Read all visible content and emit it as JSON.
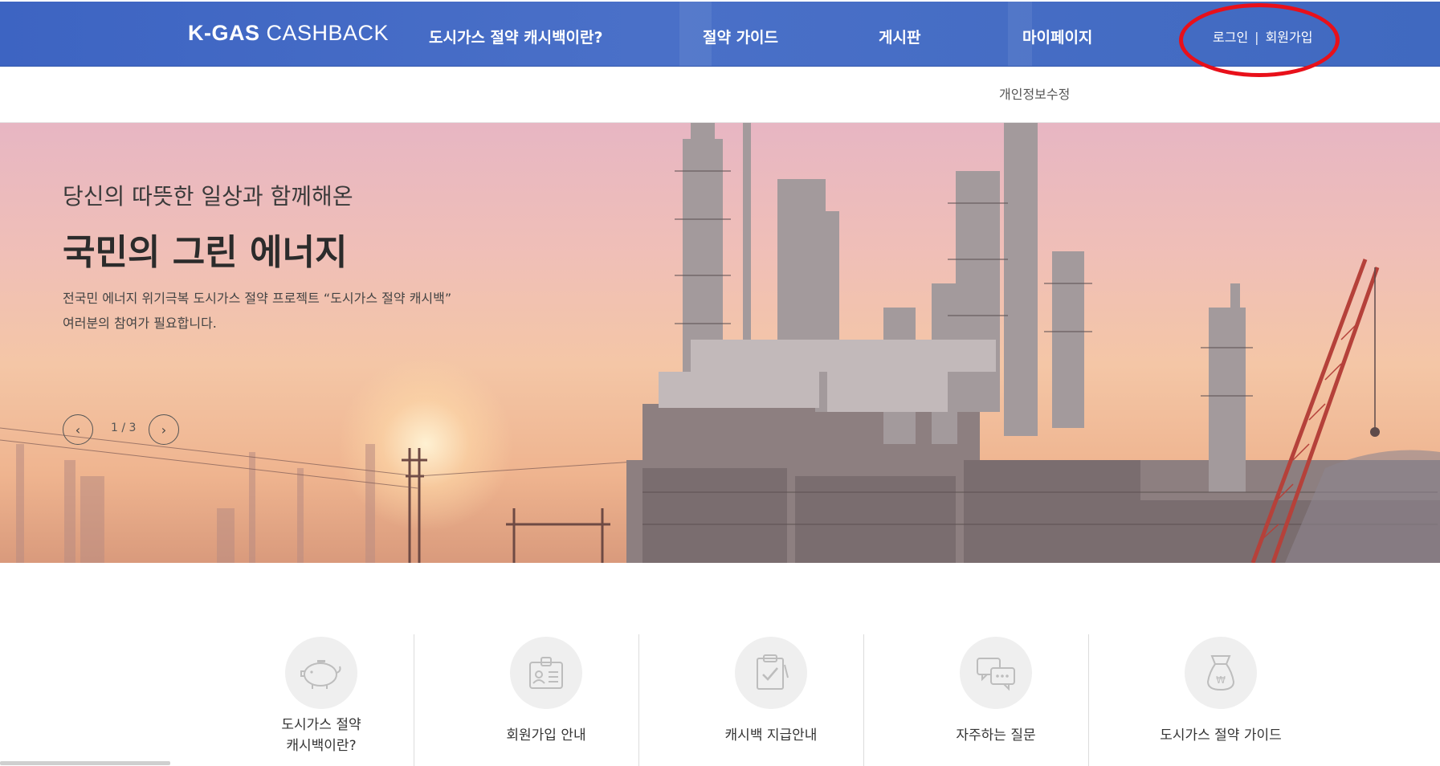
{
  "header": {
    "logo_bold": "K-GAS",
    "logo_thin": "CASHBACK",
    "nav": [
      {
        "label": "도시가스 절약 캐시백이란?"
      },
      {
        "label": "절약 가이드"
      },
      {
        "label": "게시판"
      },
      {
        "label": "마이페이지"
      }
    ],
    "login": "로그인",
    "separator": "|",
    "signup": "회원가입"
  },
  "submenu": {
    "edit_profile": "개인정보수정"
  },
  "hero": {
    "subtitle": "당신의 따뜻한 일상과 함께해온",
    "title": "국민의 그린 에너지",
    "desc_line1": "전국민 에너지 위기극복 도시가스 절약 프로젝트 “도시가스 절약 캐시백”",
    "desc_line2": "여러분의 참여가 필요합니다.",
    "prev_icon": "chevron-left-icon",
    "next_icon": "chevron-right-icon",
    "prev_glyph": "‹",
    "next_glyph": "›",
    "pager": "1 / 3"
  },
  "quick_menu": [
    {
      "icon": "piggy-bank-icon",
      "label_line1": "도시가스 절약",
      "label_line2": "캐시백이란?"
    },
    {
      "icon": "id-card-icon",
      "label_line1": "회원가입 안내",
      "label_line2": ""
    },
    {
      "icon": "clipboard-check-icon",
      "label_line1": "캐시백 지급안내",
      "label_line2": ""
    },
    {
      "icon": "chat-bubbles-icon",
      "label_line1": "자주하는 질문",
      "label_line2": ""
    },
    {
      "icon": "money-bag-icon",
      "label_line1": "도시가스 절약 가이드",
      "label_line2": ""
    }
  ],
  "colors": {
    "header_bg": "#4069c0",
    "highlight_ring": "#e8101a",
    "quick_circle": "#efefef"
  }
}
